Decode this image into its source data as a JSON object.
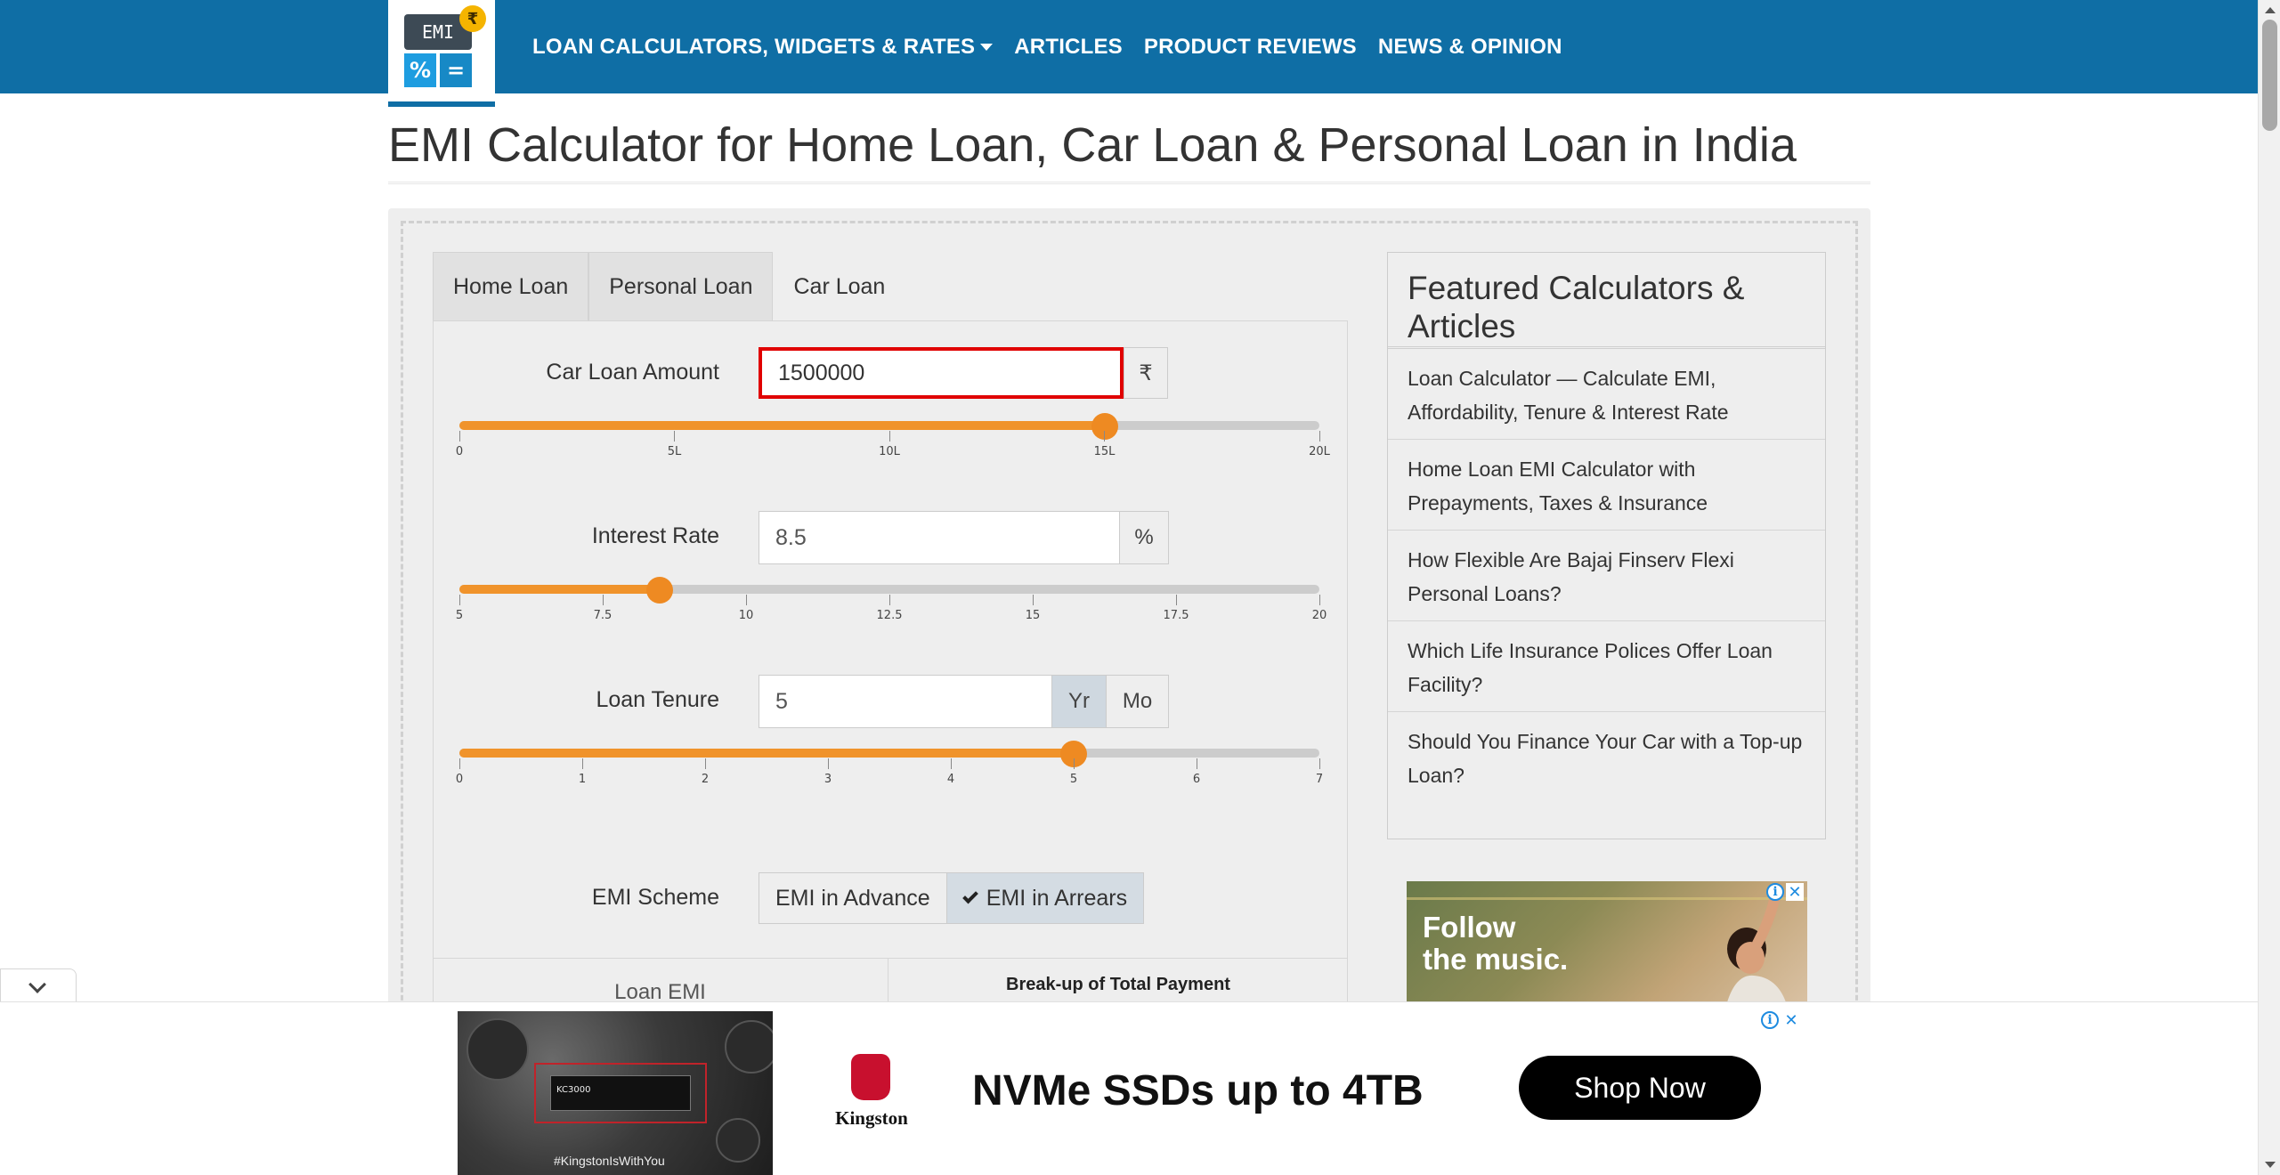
{
  "nav": {
    "logo_text": "EMI",
    "logo_coin": "₹",
    "logo_key1": "%",
    "logo_key2": "=",
    "links": [
      "LOAN CALCULATORS, WIDGETS & RATES",
      "ARTICLES",
      "PRODUCT REVIEWS",
      "NEWS & OPINION"
    ]
  },
  "page_title": "EMI Calculator for Home Loan, Car Loan & Personal Loan in India",
  "tabs": [
    "Home Loan",
    "Personal Loan",
    "Car Loan"
  ],
  "active_tab": "Car Loan",
  "fields": {
    "amount": {
      "label": "Car Loan Amount",
      "value": "1500000",
      "unit": "₹",
      "slider": {
        "min": 0,
        "max": 2000000,
        "value": 1500000,
        "ticks": [
          "0",
          "5L",
          "10L",
          "15L",
          "20L"
        ]
      }
    },
    "rate": {
      "label": "Interest Rate",
      "value": "8.5",
      "unit": "%",
      "slider": {
        "min": 5,
        "max": 20,
        "value": 8.5,
        "ticks": [
          "5",
          "7.5",
          "10",
          "12.5",
          "15",
          "17.5",
          "20"
        ]
      }
    },
    "tenure": {
      "label": "Loan Tenure",
      "value": "5",
      "unit_year": "Yr",
      "unit_month": "Mo",
      "selected_unit": "Yr",
      "slider": {
        "min": 0,
        "max": 7,
        "value": 5,
        "ticks": [
          "0",
          "1",
          "2",
          "3",
          "4",
          "5",
          "6",
          "7"
        ]
      }
    }
  },
  "emi_scheme": {
    "label": "EMI Scheme",
    "options": [
      "EMI in Advance",
      "EMI in Arrears"
    ],
    "selected": "EMI in Arrears"
  },
  "results": {
    "loan_emi_label": "Loan EMI",
    "breakup_label": "Break-up of Total Payment"
  },
  "featured": {
    "title": "Featured Calculators & Articles",
    "items": [
      "Loan Calculator — Calculate EMI, Affordability, Tenure & Interest Rate",
      "Home Loan EMI Calculator with Prepayments, Taxes & Insurance",
      "How Flexible Are Bajaj Finserv Flexi Personal Loans?",
      "Which Life Insurance Polices Offer Loan Facility?",
      "Should You Finance Your Car with a Top-up Loan?"
    ]
  },
  "side_ad": {
    "headline_line1": "Follow",
    "headline_line2": "the music.",
    "info": "i",
    "close": "✕"
  },
  "bottom_ad": {
    "ssd_label": "KC3000",
    "hashtag": "#KingstonIsWithYou",
    "brand": "Kingston",
    "headline": "NVMe SSDs up to 4TB",
    "cta": "Shop Now",
    "info": "i",
    "close": "✕"
  },
  "colors": {
    "nav_bg": "#0f6ea5",
    "slider_fill": "#f0932b",
    "focus_border": "#e00000"
  }
}
